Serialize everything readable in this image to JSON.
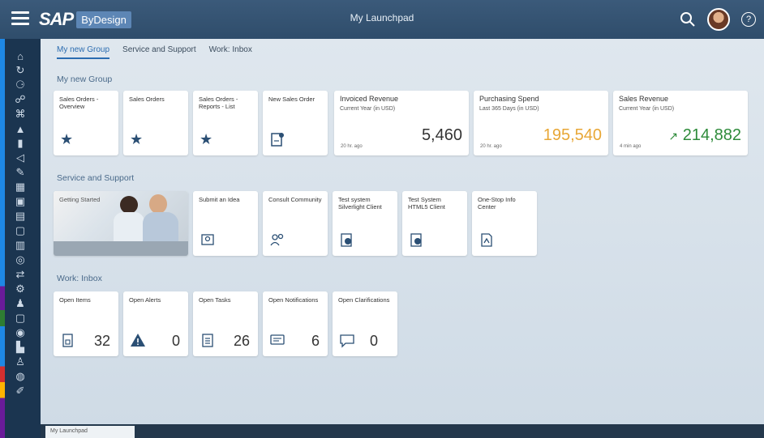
{
  "shell": {
    "logo_sap": "SAP",
    "logo_product": "ByDesign",
    "title": "My Launchpad",
    "help_label": "?"
  },
  "anchor_tabs": [
    "My new Group",
    "Service and Support",
    "Work: Inbox"
  ],
  "sections": {
    "group": "My new Group",
    "service": "Service and Support",
    "inbox": "Work: Inbox"
  },
  "group_tiles": [
    {
      "title": "Sales Orders - Overview",
      "icon": "star-icon"
    },
    {
      "title": "Sales Orders",
      "icon": "star-icon"
    },
    {
      "title": "Sales Orders - Reports - List",
      "icon": "star-icon"
    },
    {
      "title": "New Sales Order",
      "icon": "document-new-icon"
    }
  ],
  "kpis": [
    {
      "title": "Invoiced Revenue",
      "subtitle": "Current Year (in USD)",
      "value": "5,460",
      "color": "#333333",
      "footer": "20 hr. ago"
    },
    {
      "title": "Purchasing Spend",
      "subtitle": "Last 365 Days (in USD)",
      "value": "195,540",
      "color": "#e8a736",
      "footer": "20 hr. ago"
    },
    {
      "title": "Sales Revenue",
      "subtitle": "Current Year (in USD)",
      "value": "214,882",
      "arrow": "↗",
      "color": "#2e8b3a",
      "footer": "4 min ago"
    }
  ],
  "service_tiles": [
    {
      "title": "Getting Started"
    },
    {
      "title": "Submit an Idea",
      "icon": "idea-icon"
    },
    {
      "title": "Consult Community",
      "icon": "community-icon"
    },
    {
      "title": "Test system Silverlight Client",
      "icon": "silverlight-client-icon"
    },
    {
      "title": "Test System HTML5 Client",
      "icon": "html5-client-icon"
    },
    {
      "title": "One-Stop Info Center",
      "icon": "info-center-icon"
    }
  ],
  "inbox_tiles": [
    {
      "title": "Open Items",
      "icon": "items-icon",
      "count": "32"
    },
    {
      "title": "Open Alerts",
      "icon": "alert-icon",
      "count": "0"
    },
    {
      "title": "Open Tasks",
      "icon": "tasks-icon",
      "count": "26"
    },
    {
      "title": "Open Notifications",
      "icon": "notification-icon",
      "count": "6"
    },
    {
      "title": "Open Clarifications",
      "icon": "clarification-icon",
      "count": "0"
    }
  ],
  "bottom_tab": "My Launchpad",
  "colors": {
    "shell_bg": "#2f4d6b",
    "accent": "#2b6cb0",
    "rail_bg": "#1b3550"
  }
}
